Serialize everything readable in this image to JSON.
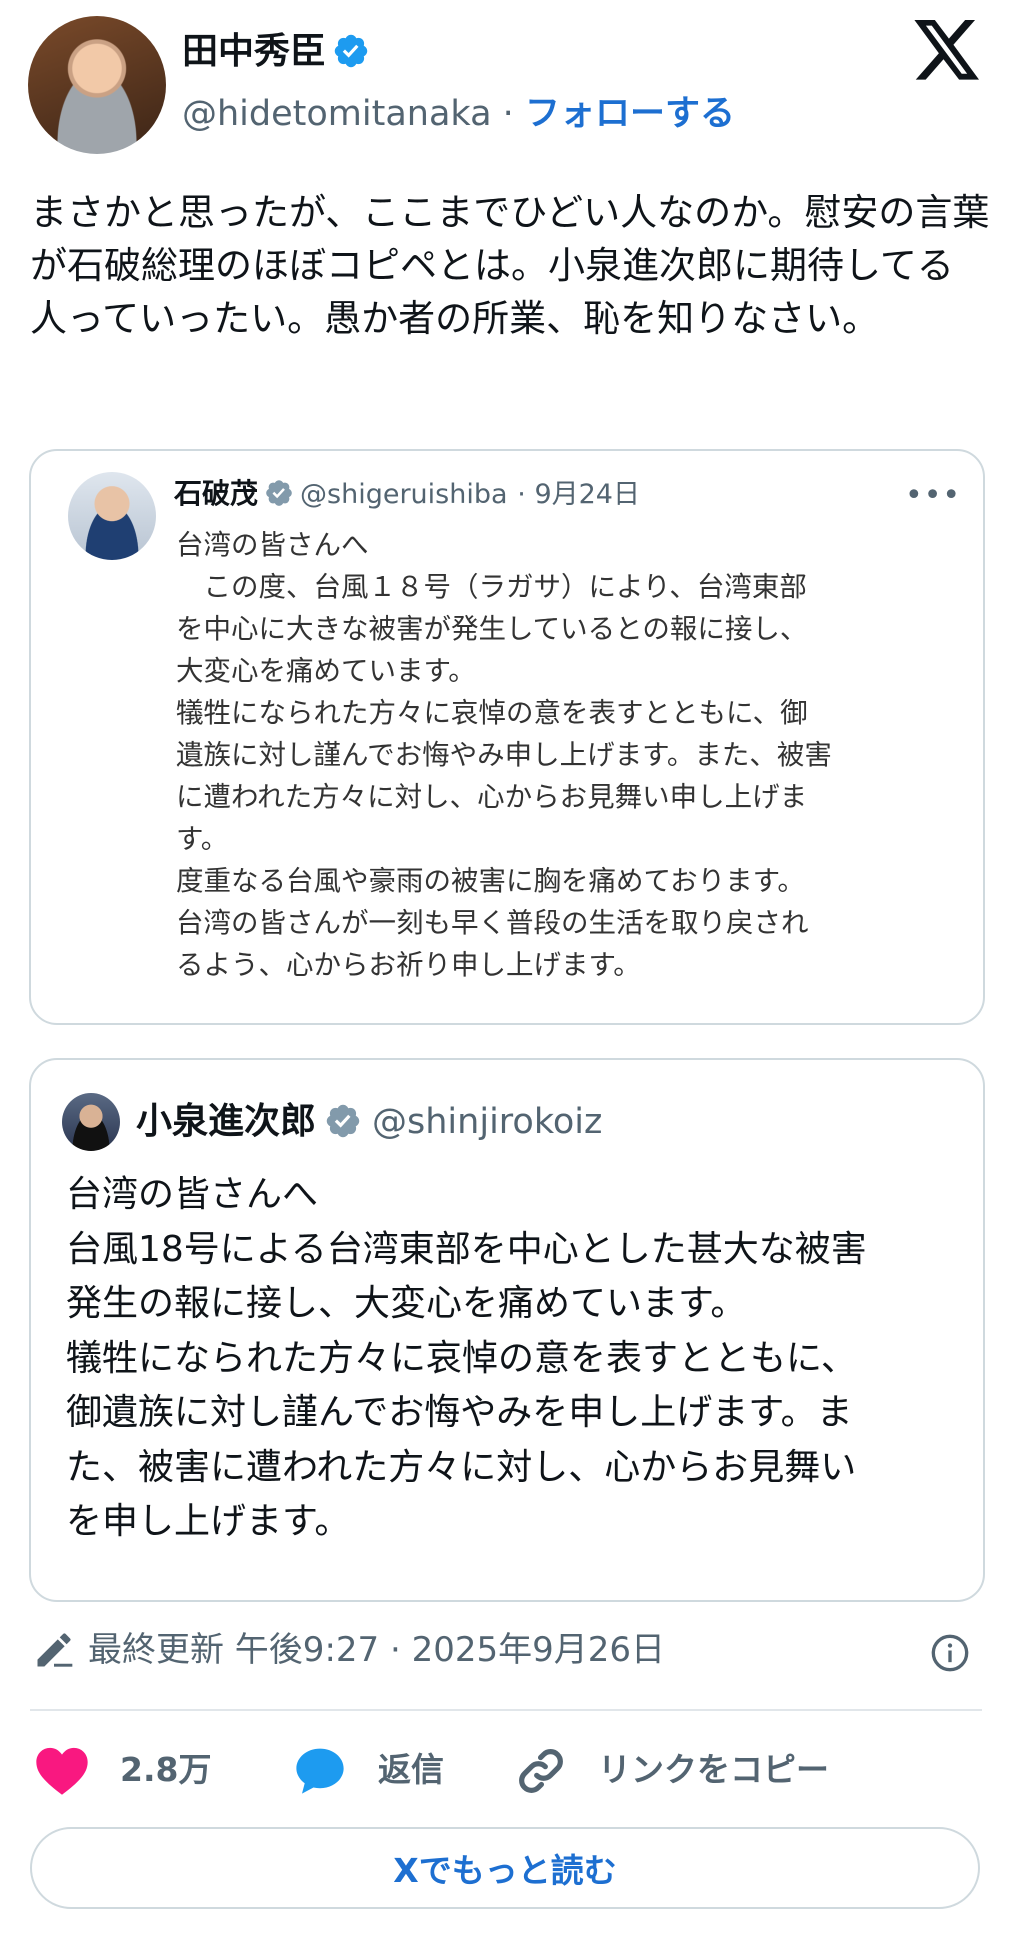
{
  "author": {
    "name": "田中秀臣",
    "handle": "@hidetomitanaka",
    "separator": "·",
    "follow_label": "フォローする"
  },
  "tweet": {
    "text": "まさかと思ったが、ここまでひどい人なのか。慰安の言葉が石破総理のほぼコピペとは。小泉進次郎に期待してる人っていったい。愚か者の所業、恥を知りなさい。"
  },
  "quote1": {
    "name": "石破茂",
    "handle": "@shigeruishiba",
    "date": "· 9月24日",
    "more": "•••",
    "lines": [
      "台湾の皆さんへ",
      "　この度、台風１８号（ラガサ）により、台湾東部",
      "を中心に大きな被害が発生しているとの報に接し、",
      "大変心を痛めています。",
      "犠牲になられた方々に哀悼の意を表すとともに、御",
      "遺族に対し謹んでお悔やみ申し上げます。また、被害",
      "に遭われた方々に対し、心からお見舞い申し上げま",
      "す。",
      "度重なる台風や豪雨の被害に胸を痛めております。",
      "台湾の皆さんが一刻も早く普段の生活を取り戻され",
      "るよう、心からお祈り申し上げます。"
    ]
  },
  "quote2": {
    "name": "小泉進次郎",
    "handle": "@shinjirokoiz",
    "lines": [
      "台湾の皆さんへ",
      "台風18号による台湾東部を中心とした甚大な被害",
      "発生の報に接し、大変心を痛めています。",
      "犠牲になられた方々に哀悼の意を表すとともに、",
      "御遺族に対し謹んでお悔やみを申し上げます。ま",
      "た、被害に遭われた方々に対し、心からお見舞い",
      "を申し上げます。"
    ]
  },
  "meta": {
    "timestamp": "最終更新 午後9:27 · 2025年9月26日"
  },
  "actions": {
    "likes": "2.8万",
    "reply_label": "返信",
    "copy_link_label": "リンクをコピー",
    "read_more_label": "Xでもっと読む"
  },
  "colors": {
    "accent": "#1d6fd1",
    "verified": "#1d9bf0",
    "heart": "#f91880",
    "muted": "#536471"
  }
}
